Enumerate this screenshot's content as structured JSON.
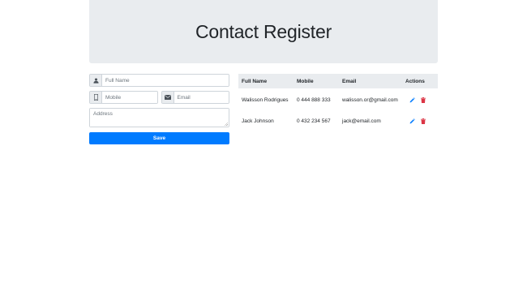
{
  "header": {
    "title": "Contact Register"
  },
  "form": {
    "full_name": {
      "placeholder": "Full Name",
      "value": ""
    },
    "mobile": {
      "placeholder": "Mobile",
      "value": ""
    },
    "email": {
      "placeholder": "Email",
      "value": ""
    },
    "address": {
      "placeholder": "Address",
      "value": ""
    },
    "save_label": "Save"
  },
  "table": {
    "columns": [
      "Full Name",
      "Mobile",
      "Email",
      "Actions"
    ],
    "rows": [
      {
        "name": "Walisson Rodrigues",
        "mobile": "0 444 888 333",
        "email": "walisson.or@gmail.com"
      },
      {
        "name": "Jack Johnson",
        "mobile": "0 432 234 567",
        "email": "jack@email.com"
      }
    ]
  },
  "icons": {
    "full_name": "user-icon",
    "mobile": "mobile-phone-icon",
    "email": "envelope-icon",
    "edit": "pencil-icon",
    "delete": "trash-icon"
  },
  "colors": {
    "primary": "#007bff",
    "danger": "#dc3545",
    "header_bg": "#e9ecef"
  }
}
